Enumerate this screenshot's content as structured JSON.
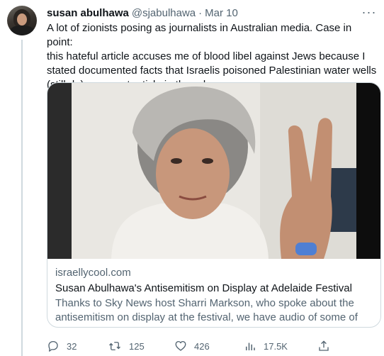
{
  "tweet": {
    "author_name": "susan abulhawa",
    "handle": "@sjabulhawa",
    "separator": "·",
    "date": "Mar 10",
    "more_label": "···",
    "text_lines": [
      "A lot of zionists posing as journalists in Australian media. Case in point:",
      "this hateful article accuses me of blood libel against Jews because I",
      "stated documented facts that Israelis poisoned Palestinian water wells",
      "(still do). see next article in thread."
    ]
  },
  "link_card": {
    "domain": "israellycool.com",
    "title": "Susan Abulhawa's Antisemitism on Display at Adelaide Festival",
    "description": "Thanks to Sky News host Sharri Markson, who spoke about the antisemitism on display at the festival, we have audio of some of her..."
  },
  "actions": {
    "replies": "32",
    "reposts": "125",
    "likes": "426",
    "views": "17.5K"
  },
  "colors": {
    "text_primary": "#0f1419",
    "text_secondary": "#536471",
    "border": "#cfd9de",
    "background": "#ffffff"
  },
  "icons": {
    "reply": "reply-icon",
    "repost": "repost-icon",
    "like": "heart-icon",
    "views": "bar-chart-icon",
    "share": "share-icon",
    "more": "more-icon"
  }
}
